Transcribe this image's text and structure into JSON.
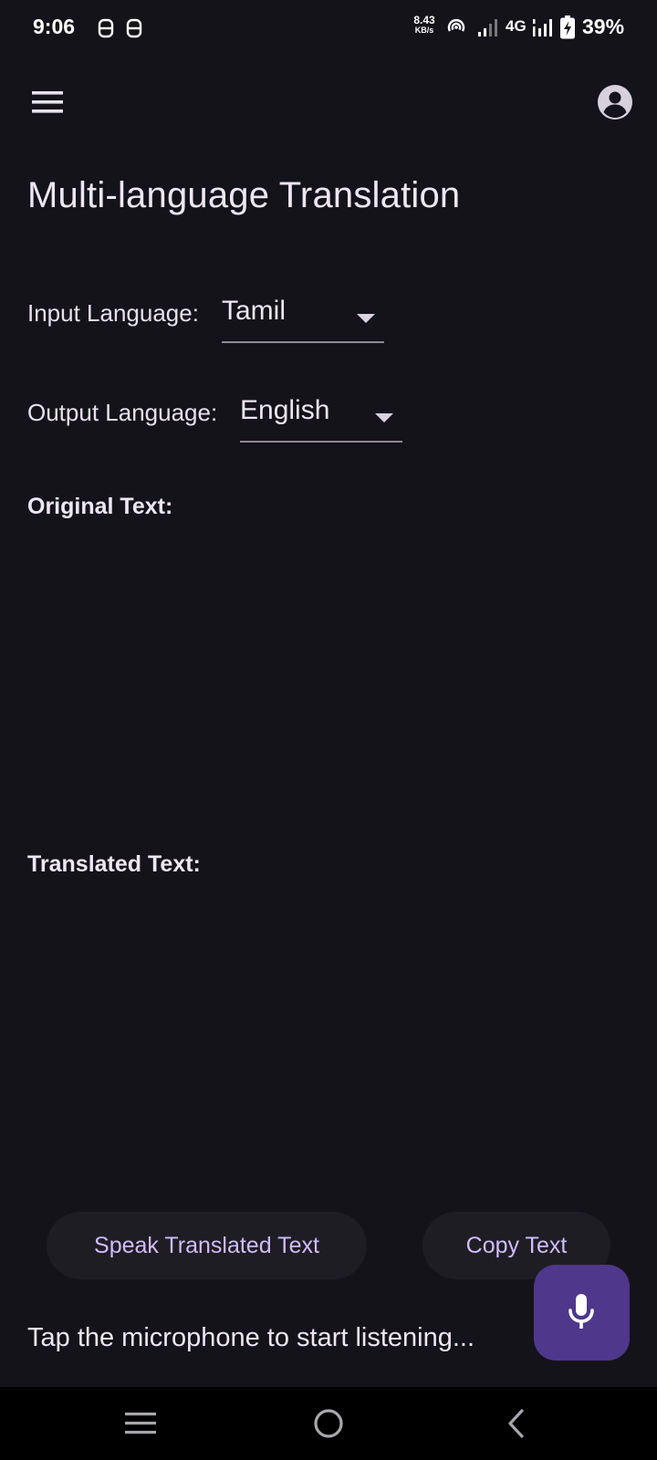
{
  "status_bar": {
    "time": "9:06",
    "net_speed_value": "8.43",
    "net_speed_unit": "KB/s",
    "network_type": "4G",
    "battery_percent": "39%"
  },
  "app_bar": {
    "menu_icon": "menu-icon",
    "account_icon": "account-circle-icon"
  },
  "page": {
    "title": "Multi-language Translation"
  },
  "input_language": {
    "label": "Input Language:",
    "selected": "Tamil"
  },
  "output_language": {
    "label": "Output Language:",
    "selected": "English"
  },
  "original": {
    "label": "Original Text:",
    "text": ""
  },
  "translated": {
    "label": "Translated Text:",
    "text": ""
  },
  "actions": {
    "speak_label": "Speak Translated Text",
    "copy_label": "Copy Text"
  },
  "listening_status": "Tap the microphone to start listening...",
  "mic_button_icon": "microphone-icon",
  "colors": {
    "background": "#15131a",
    "button_background": "#1f1d24",
    "button_text": "#cfbcfb",
    "fab_background": "#4f378b",
    "nav_bar": "#000000"
  },
  "nav_bar": {
    "recents_icon": "recents-icon",
    "home_icon": "home-icon",
    "back_icon": "back-icon"
  }
}
